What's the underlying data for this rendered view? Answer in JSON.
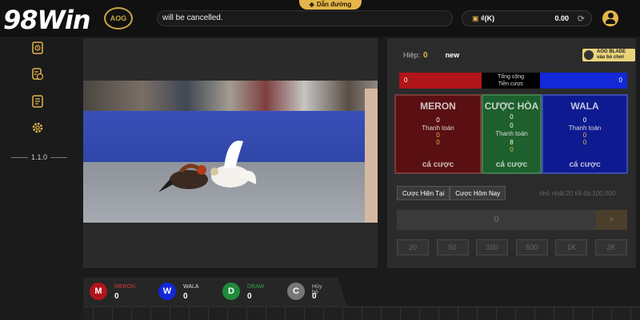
{
  "header": {
    "logo_text": "98Win",
    "badge_text": "AOG",
    "ticker_text": "will be cancelled.",
    "guide_label": "Dẫn đường",
    "wallet": {
      "currency": "₫(K)",
      "balance": "0.00"
    }
  },
  "sidebar": {
    "items": [
      {
        "icon": "history-icon"
      },
      {
        "icon": "bet-record-icon"
      },
      {
        "icon": "statement-icon"
      },
      {
        "icon": "settings-icon"
      }
    ],
    "version": "1.1.0"
  },
  "bet_panel": {
    "round_label": "Hiệp:",
    "round_number": "0",
    "round_status": "new",
    "aog_badge": {
      "line1": "AOG BLADE",
      "line2": "vào bỏ chơi"
    },
    "totals": {
      "red_value": "0",
      "mid_line1": "Tổng cộng",
      "mid_line2": "Tiền cược",
      "blue_value": "0"
    },
    "choices": {
      "meron": {
        "name": "MERON",
        "a": "0",
        "pay_label": "Thanh toán",
        "b": "0",
        "c": "0",
        "cta": "cá cược"
      },
      "draw": {
        "name": "CƯỢC HÒA",
        "a": "0",
        "a2": "0",
        "pay_label": "Thanh toán",
        "b": "8",
        "c": "0",
        "cta": "cá cược"
      },
      "wala": {
        "name": "WALA",
        "a": "0",
        "pay_label": "Thanh toán",
        "b": "0",
        "c": "0",
        "cta": "cá cược"
      }
    },
    "tabs": [
      "Cược Hiện Tại",
      "Cược Hôm Nay"
    ],
    "limits": "nhỏ nhất:20   tối đa:100,000",
    "amount": "0",
    "clear": "×",
    "chips": [
      "20",
      "50",
      "100",
      "500",
      "1K",
      "2K"
    ]
  },
  "scoreboard": [
    {
      "letter": "M",
      "label": "MERON",
      "value": "0",
      "color": "#b0151a"
    },
    {
      "letter": "W",
      "label": "WALA",
      "value": "0",
      "color": "#1328d8"
    },
    {
      "letter": "D",
      "label": "DRAW",
      "value": "0",
      "color": "#1f8a3a"
    },
    {
      "letter": "C",
      "label": "Hủy bỏ",
      "value": "0",
      "color": "#777777"
    }
  ]
}
